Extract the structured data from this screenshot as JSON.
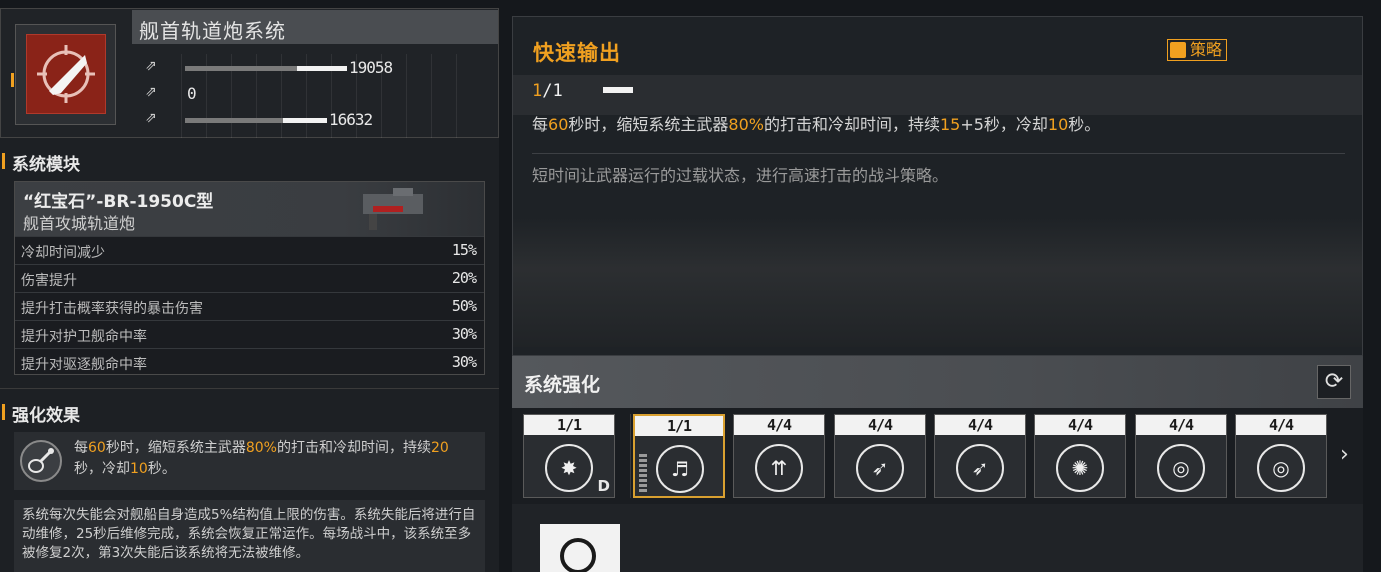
{
  "weapon": {
    "title": "舰首轨道炮系统",
    "icon": "bullet-crosshair-icon",
    "stats": [
      {
        "icon": "attack-stat-icon",
        "value": "19058",
        "fill": 0.6
      },
      {
        "icon": "armor-stat-icon",
        "value": "0",
        "fill": 0
      },
      {
        "icon": "siege-stat-icon",
        "value": "16632",
        "fill": 0.55
      }
    ]
  },
  "module": {
    "section_title": "系统模块",
    "name_line1": "“红宝石”-BR-1950C型",
    "name_line2": "舰首攻城轨道炮",
    "rows": [
      {
        "label": "冷却时间减少",
        "value": "15%"
      },
      {
        "label": "伤害提升",
        "value": "20%"
      },
      {
        "label": "提升打击概率获得的暴击伤害",
        "value": "50%"
      },
      {
        "label": "提升对护卫舰命中率",
        "value": "30%"
      },
      {
        "label": "提升对驱逐舰命中率",
        "value": "30%"
      }
    ]
  },
  "effect": {
    "section_title": "强化效果",
    "icon": "guitar-enhance-icon",
    "text_parts": [
      "每",
      "60",
      "秒时，缩短系统主武器",
      "80%",
      "的打击和冷却时间，持续",
      "20",
      "秒，冷却",
      "10",
      "秒。"
    ],
    "note": "系统每次失能会对舰船自身造成5%结构值上限的伤害。系统失能后将进行自动维修，25秒后维修完成，系统会恢复正常运作。每场战斗中，该系统至多被修复2次，第3次失能后该系统将无法被维修。"
  },
  "skill": {
    "title": "快速输出",
    "badge": "策略",
    "level_current": "1",
    "level_sep": "/1",
    "desc_parts": [
      "每",
      "60",
      "秒时，缩短系统主武器",
      "80%",
      "的打击和冷却时间，持续",
      "15",
      "+5秒，冷却",
      "10",
      "秒。"
    ],
    "flavor": "短时间让武器运行的过载状态，进行高速打击的战斗策略。"
  },
  "enhance": {
    "title": "系统强化",
    "refresh_icon": "refresh-icon",
    "slots": [
      {
        "count": "1/1",
        "icon": "explosion-icon",
        "mark": "D",
        "selected": false
      },
      {
        "count": "1/1",
        "icon": "guitar-enhance-icon",
        "mark": "",
        "selected": true
      },
      {
        "count": "4/4",
        "icon": "triple-arrow-up-icon",
        "mark": "",
        "selected": false
      },
      {
        "count": "4/4",
        "icon": "missile-up-icon",
        "mark": "",
        "selected": false
      },
      {
        "count": "4/4",
        "icon": "missile-up-icon",
        "mark": "",
        "selected": false
      },
      {
        "count": "4/4",
        "icon": "burst-icon",
        "mark": "",
        "selected": false
      },
      {
        "count": "4/4",
        "icon": "radar-target-icon",
        "mark": "",
        "selected": false
      },
      {
        "count": "4/4",
        "icon": "radar-target-icon",
        "mark": "",
        "selected": false
      }
    ],
    "next_icon": "chevron-right-icon"
  }
}
